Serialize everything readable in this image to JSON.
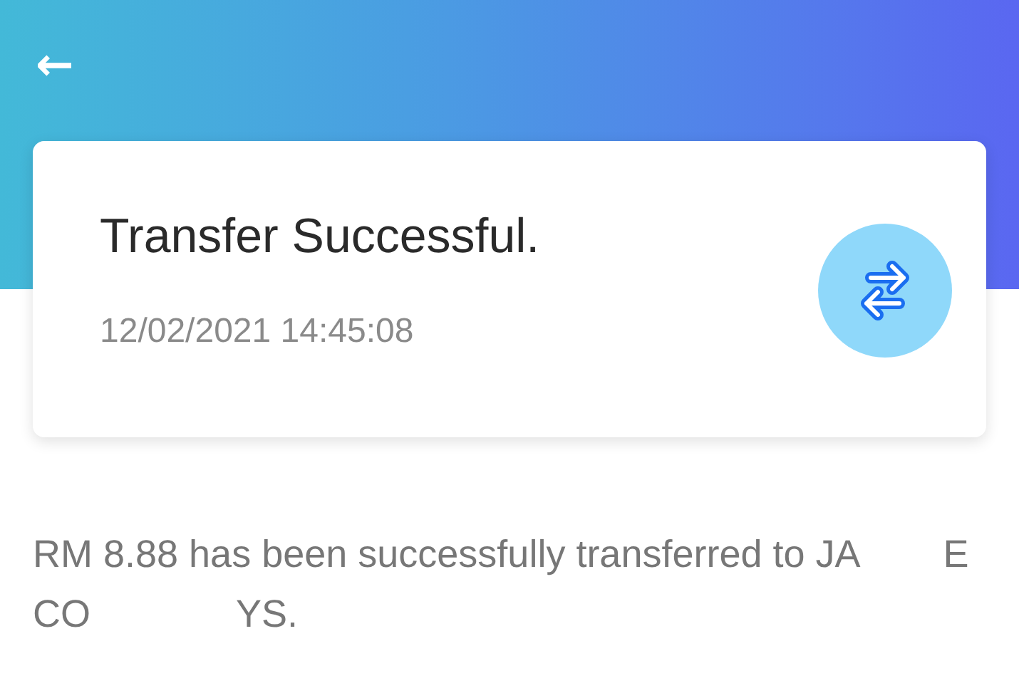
{
  "header": {
    "back_icon": "←"
  },
  "card": {
    "title": "Transfer Successful.",
    "timestamp": "12/02/2021 14:45:08"
  },
  "message_parts": [
    "RM 8.88 has been successfully transferred to JA",
    "E",
    "CO",
    "YS."
  ]
}
